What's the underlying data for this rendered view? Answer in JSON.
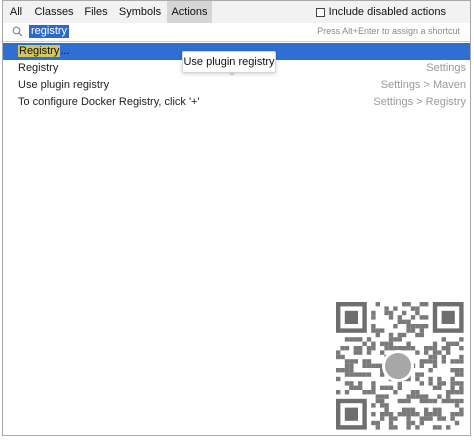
{
  "tabs": [
    {
      "label": "All"
    },
    {
      "label": "Classes"
    },
    {
      "label": "Files"
    },
    {
      "label": "Symbols"
    },
    {
      "label": "Actions",
      "active": true
    }
  ],
  "include_disabled": {
    "label": "Include disabled actions",
    "checked": false
  },
  "search": {
    "value": "registry",
    "hint": "Press Alt+Enter to assign a shortcut"
  },
  "results": [
    {
      "label_match": "Registry",
      "label_rest": "...",
      "context": "",
      "selected": true
    },
    {
      "label": "Registry",
      "context": "Settings"
    },
    {
      "label": "Use plugin registry",
      "context": "Settings > Maven"
    },
    {
      "label": "To configure Docker Registry, click '+'",
      "context": "Settings > Registry"
    }
  ],
  "tooltip": {
    "text": "Use plugin registry"
  },
  "colors": {
    "selection": "#2f6fd1",
    "match_highlight": "#d4c55a",
    "input_selection": "#2c69c8"
  },
  "icons": {
    "search": "search-icon",
    "checkbox": "checkbox-icon",
    "qr": "qr-code-image"
  }
}
